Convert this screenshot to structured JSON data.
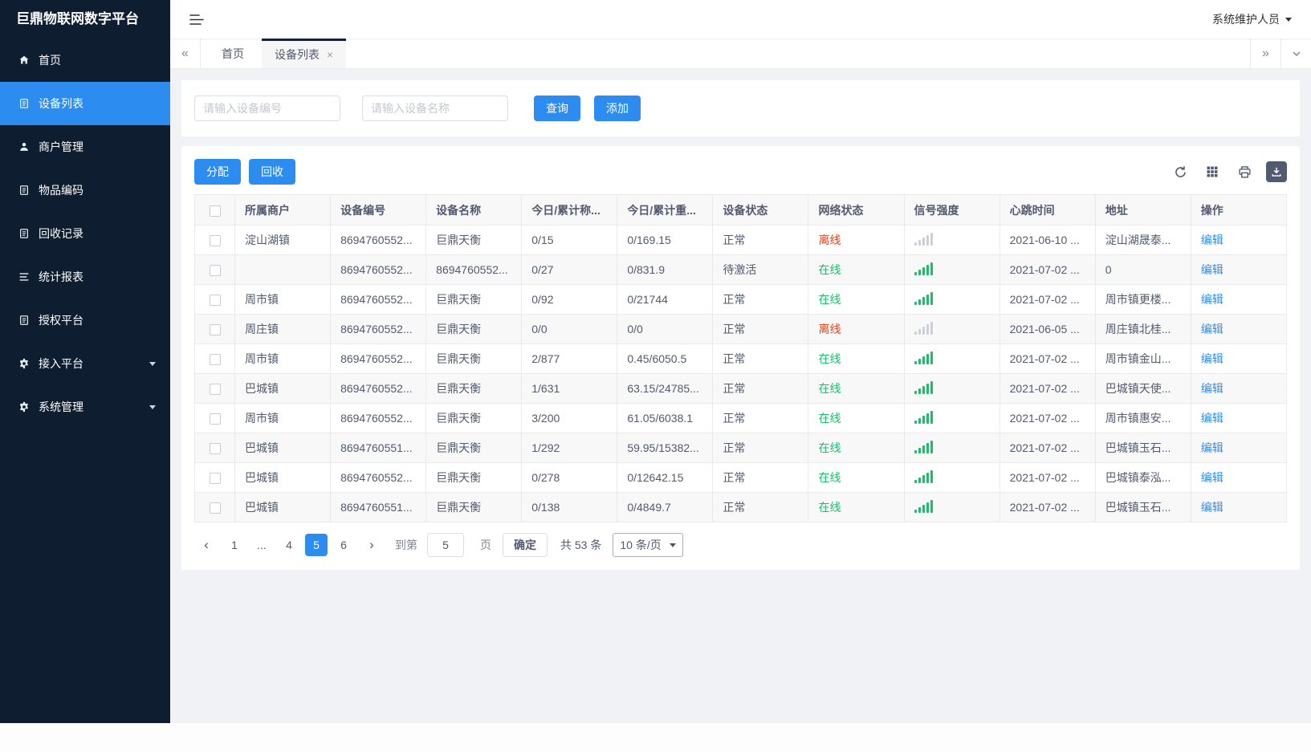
{
  "app": {
    "logo": "巨鼎物联网数字平台",
    "user": "系统维护人员"
  },
  "icons": {
    "tab_close": "×",
    "scroll_left": "«",
    "scroll_right": "»",
    "page_prev": "‹",
    "page_next": "›"
  },
  "colors": {
    "primary": "#2d8cf0",
    "online_green": "#19be6b",
    "offline_red": "#ed4014",
    "sidebar_bg": "#0e1d30"
  },
  "sidebar": {
    "items": [
      {
        "name": "home",
        "label": "首页",
        "icon": "home-icon",
        "active": false,
        "expandable": false
      },
      {
        "name": "device-list",
        "label": "设备列表",
        "icon": "device-list-icon",
        "active": true,
        "expandable": false
      },
      {
        "name": "merchant-management",
        "label": "商户管理",
        "icon": "merchant-icon",
        "active": false,
        "expandable": false
      },
      {
        "name": "item-coding",
        "label": "物品编码",
        "icon": "item-code-icon",
        "active": false,
        "expandable": false
      },
      {
        "name": "recycle-records",
        "label": "回收记录",
        "icon": "recycle-record-icon",
        "active": false,
        "expandable": false
      },
      {
        "name": "statistics-report",
        "label": "统计报表",
        "icon": "report-icon",
        "active": false,
        "expandable": false
      },
      {
        "name": "authorization-platform",
        "label": "授权平台",
        "icon": "auth-platform-icon",
        "active": false,
        "expandable": false
      },
      {
        "name": "access-platform",
        "label": "接入平台",
        "icon": "access-platform-icon",
        "active": false,
        "expandable": true
      },
      {
        "name": "system-management",
        "label": "系统管理",
        "icon": "system-settings-icon",
        "active": false,
        "expandable": true
      }
    ]
  },
  "tabbar": {
    "tabs": [
      {
        "name": "home",
        "label": "首页",
        "active": false,
        "closable": false
      },
      {
        "name": "device-list",
        "label": "设备列表",
        "active": true,
        "closable": true
      }
    ]
  },
  "search": {
    "device_no_placeholder": "请输入设备编号",
    "device_name_placeholder": "请输入设备名称",
    "query_label": "查询",
    "add_label": "添加"
  },
  "actions": {
    "assign_label": "分配",
    "recycle_label": "回收"
  },
  "table": {
    "columns": [
      "所属商户",
      "设备编号",
      "设备名称",
      "今日/累计称...",
      "今日/累计重...",
      "设备状态",
      "网络状态",
      "信号强度",
      "心跳时间",
      "地址",
      "操作"
    ],
    "rows": [
      {
        "merchant": "淀山湖镇",
        "device_no": "8694760552...",
        "device_name": "巨鼎天衡",
        "today_count": "0/15",
        "today_weight": "0/169.15",
        "device_status": "正常",
        "network_status": "离线",
        "online": false,
        "signal": "weak",
        "heartbeat": "2021-06-10 ...",
        "address": "淀山湖晟泰...",
        "action": "编辑"
      },
      {
        "merchant": "",
        "device_no": "8694760552...",
        "device_name": "8694760552...",
        "today_count": "0/27",
        "today_weight": "0/831.9",
        "device_status": "待激活",
        "network_status": "在线",
        "online": true,
        "signal": "strong",
        "heartbeat": "2021-07-02 ...",
        "address": "0",
        "action": "编辑"
      },
      {
        "merchant": "周市镇",
        "device_no": "8694760552...",
        "device_name": "巨鼎天衡",
        "today_count": "0/92",
        "today_weight": "0/21744",
        "device_status": "正常",
        "network_status": "在线",
        "online": true,
        "signal": "strong",
        "heartbeat": "2021-07-02 ...",
        "address": "周市镇更楼...",
        "action": "编辑"
      },
      {
        "merchant": "周庄镇",
        "device_no": "8694760552...",
        "device_name": "巨鼎天衡",
        "today_count": "0/0",
        "today_weight": "0/0",
        "device_status": "正常",
        "network_status": "离线",
        "online": false,
        "signal": "weak",
        "heartbeat": "2021-06-05 ...",
        "address": "周庄镇北桂...",
        "action": "编辑"
      },
      {
        "merchant": "周市镇",
        "device_no": "8694760552...",
        "device_name": "巨鼎天衡",
        "today_count": "2/877",
        "today_weight": "0.45/6050.5",
        "device_status": "正常",
        "network_status": "在线",
        "online": true,
        "signal": "strong",
        "heartbeat": "2021-07-02 ...",
        "address": "周市镇金山...",
        "action": "编辑"
      },
      {
        "merchant": "巴城镇",
        "device_no": "8694760552...",
        "device_name": "巨鼎天衡",
        "today_count": "1/631",
        "today_weight": "63.15/24785...",
        "device_status": "正常",
        "network_status": "在线",
        "online": true,
        "signal": "strong",
        "heartbeat": "2021-07-02 ...",
        "address": "巴城镇天使...",
        "action": "编辑"
      },
      {
        "merchant": "周市镇",
        "device_no": "8694760552...",
        "device_name": "巨鼎天衡",
        "today_count": "3/200",
        "today_weight": "61.05/6038.1",
        "device_status": "正常",
        "network_status": "在线",
        "online": true,
        "signal": "strong",
        "heartbeat": "2021-07-02 ...",
        "address": "周市镇惠安...",
        "action": "编辑"
      },
      {
        "merchant": "巴城镇",
        "device_no": "8694760551...",
        "device_name": "巨鼎天衡",
        "today_count": "1/292",
        "today_weight": "59.95/15382...",
        "device_status": "正常",
        "network_status": "在线",
        "online": true,
        "signal": "strong",
        "heartbeat": "2021-07-02 ...",
        "address": "巴城镇玉石...",
        "action": "编辑"
      },
      {
        "merchant": "巴城镇",
        "device_no": "8694760552...",
        "device_name": "巨鼎天衡",
        "today_count": "0/278",
        "today_weight": "0/12642.15",
        "device_status": "正常",
        "network_status": "在线",
        "online": true,
        "signal": "strong",
        "heartbeat": "2021-07-02 ...",
        "address": "巴城镇泰泓...",
        "action": "编辑"
      },
      {
        "merchant": "巴城镇",
        "device_no": "8694760551...",
        "device_name": "巨鼎天衡",
        "today_count": "0/138",
        "today_weight": "0/4849.7",
        "device_status": "正常",
        "network_status": "在线",
        "online": true,
        "signal": "strong",
        "heartbeat": "2021-07-02 ...",
        "address": "巴城镇玉石...",
        "action": "编辑"
      }
    ]
  },
  "pagination": {
    "pages": [
      {
        "label": "1",
        "active": false,
        "ellipsis": false
      },
      {
        "label": "...",
        "active": false,
        "ellipsis": true
      },
      {
        "label": "4",
        "active": false,
        "ellipsis": false
      },
      {
        "label": "5",
        "active": true,
        "ellipsis": false
      },
      {
        "label": "6",
        "active": false,
        "ellipsis": false
      }
    ],
    "goto_prefix": "到第",
    "goto_value": "5",
    "goto_suffix": "页",
    "confirm_label": "确定",
    "total_text": "共 53 条",
    "page_size_text": "10 条/页"
  }
}
